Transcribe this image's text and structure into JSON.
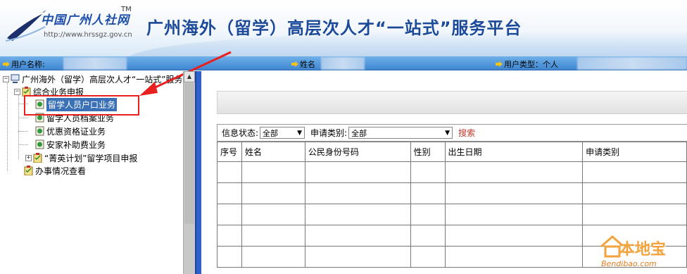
{
  "header": {
    "logo_text": "中国广州人社网",
    "logo_tm": "TM",
    "logo_url": "http://www.hrssgz.gov.cn",
    "site_title": "广州海外（留学）高层次人才“一站式”服务平台"
  },
  "infobar": {
    "username_label": "用户名称:",
    "name_label": "姓名",
    "usertype_label": "用户类型：个人"
  },
  "sidebar": {
    "root_label": "广州海外（留学）高层次人才“一站式”服务",
    "group_label": "综合业务申报",
    "items": [
      {
        "label": "留学人员户口业务"
      },
      {
        "label": "留学人员档案业务"
      },
      {
        "label": "优惠资格证业务"
      },
      {
        "label": "安家补助费业务"
      },
      {
        "label": "“菁英计划”留学项目申报"
      },
      {
        "label": "办事情况查看"
      }
    ]
  },
  "filters": {
    "status_label": "信息状态:",
    "status_value": "全部",
    "type_label": "申请类别:",
    "type_value": "全部",
    "search_label": "搜索"
  },
  "table": {
    "columns": [
      "序号",
      "姓名",
      "公民身份号码",
      "性别",
      "出生日期",
      "申请类别"
    ]
  },
  "watermark": {
    "text": "本地宝",
    "url": "Bendibao.com"
  }
}
